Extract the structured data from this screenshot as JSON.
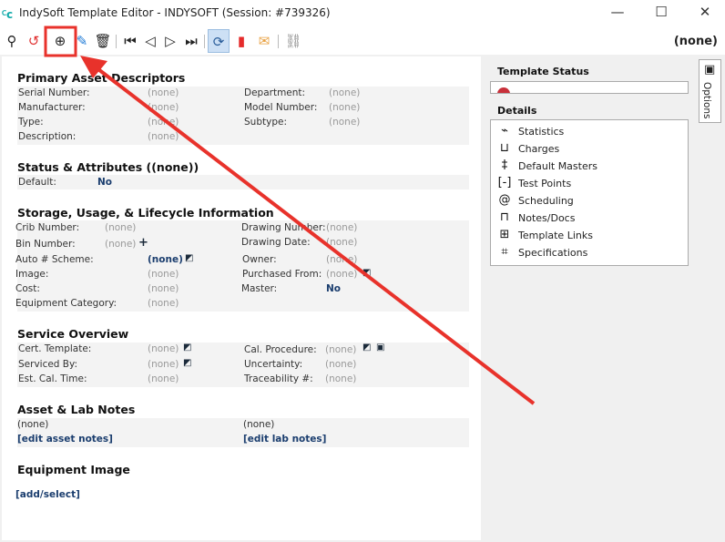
{
  "window": {
    "title": "IndySoft Template Editor - INDYSOFT (Session: #739326)",
    "minimize": "—",
    "maximize": "☐",
    "close": "✕"
  },
  "toolbar": {
    "record_label": "(none)",
    "icons": [
      "search-icon",
      "history-icon",
      "add-icon",
      "edit-icon",
      "delete-icon",
      "first-icon",
      "previous-icon",
      "next-icon",
      "last-icon",
      "refresh-icon",
      "bookmark-icon",
      "email-icon",
      "link-icon"
    ]
  },
  "primary": {
    "title": "Primary Asset Descriptors",
    "rows": [
      [
        "Serial Number:",
        "(none)",
        "Department:",
        "(none)"
      ],
      [
        "Manufacturer:",
        "(none)",
        "Model Number:",
        "(none)"
      ],
      [
        "Type:",
        "(none)",
        "Subtype:",
        "(none)"
      ],
      [
        "Description:",
        "(none)"
      ]
    ]
  },
  "status": {
    "title": "Status & Attributes ((none))",
    "label": "Default:",
    "value": "No"
  },
  "storage": {
    "title": "Storage, Usage, & Lifecycle Information",
    "rows": [
      [
        "Crib Number:",
        "(none)",
        "Drawing Number:",
        "(none)"
      ],
      [
        "Bin Number:",
        "(none)",
        "Drawing Date:",
        "(none)"
      ],
      [
        "Auto # Scheme:",
        "(none)",
        "Owner:",
        "(none)"
      ],
      [
        "Image:",
        "(none)",
        "Purchased From:",
        "(none)"
      ],
      [
        "Cost:",
        "(none)",
        "Master:",
        "No"
      ],
      [
        "Equipment Category:",
        "(none)"
      ]
    ]
  },
  "service": {
    "title": "Service Overview",
    "rows": [
      [
        "Cert. Template:",
        "(none)",
        "Cal. Procedure:",
        "(none)"
      ],
      [
        "Serviced By:",
        "(none)",
        "Uncertainty:",
        "(none)"
      ],
      [
        "Est. Cal. Time:",
        "(none)",
        "Traceability #:",
        "(none)"
      ]
    ]
  },
  "notes": {
    "title": "Asset & Lab Notes",
    "asset": "(none)",
    "lab": "(none)",
    "edit_asset": "[edit asset notes]",
    "edit_lab": "[edit lab notes]"
  },
  "image": {
    "title": "Equipment Image",
    "add": "[add/select]"
  },
  "side": {
    "template_status": "Template Status",
    "details_title": "Details",
    "options": "Options",
    "details": [
      {
        "label": "Statistics",
        "icon": "statistics-icon"
      },
      {
        "label": "Charges",
        "icon": "charges-icon"
      },
      {
        "label": "Default Masters",
        "icon": "masters-icon"
      },
      {
        "label": "Test Points",
        "icon": "test-points-icon"
      },
      {
        "label": "Scheduling",
        "icon": "paperclip-icon"
      },
      {
        "label": "Notes/Docs",
        "icon": "book-icon"
      },
      {
        "label": "Template Links",
        "icon": "grid-icon"
      },
      {
        "label": "Specifications",
        "icon": "crop-icon"
      }
    ]
  },
  "annotation": {
    "color": "#e8322b"
  }
}
